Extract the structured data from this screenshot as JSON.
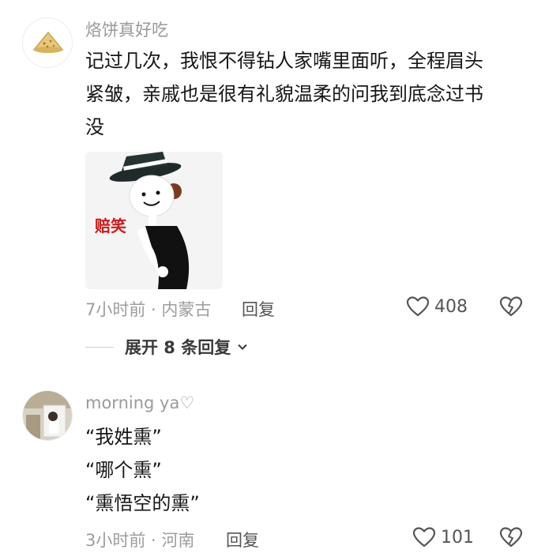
{
  "comments": [
    {
      "username": "烙饼真好吃",
      "avatar": "flatbread-avatar",
      "lines": [
        "记过几次，我恨不得钻人家嘴里面听，全程眉头",
        "紧皱，亲戚也是很有礼貌温柔的问我到底念过书",
        "没"
      ],
      "sticker_caption": "赔笑",
      "time_location": "7小时前 · 内蒙古",
      "reply_label": "回复",
      "likes": "408",
      "expand_label": "展开 8 条回复"
    },
    {
      "username": "morning ya♡",
      "avatar": "portrait-avatar",
      "lines": [
        "“我姓熏”",
        "“哪个熏”",
        "“熏悟空的熏”"
      ],
      "time_location": "3小时前 · 河南",
      "reply_label": "回复",
      "likes": "101"
    }
  ],
  "colors": {
    "meta_gray": "#9d9d9d",
    "text": "#161616",
    "sticker_caption": "#d01a1a"
  },
  "icons": [
    "heart-outline-icon",
    "broken-heart-icon",
    "chevron-down-icon"
  ]
}
